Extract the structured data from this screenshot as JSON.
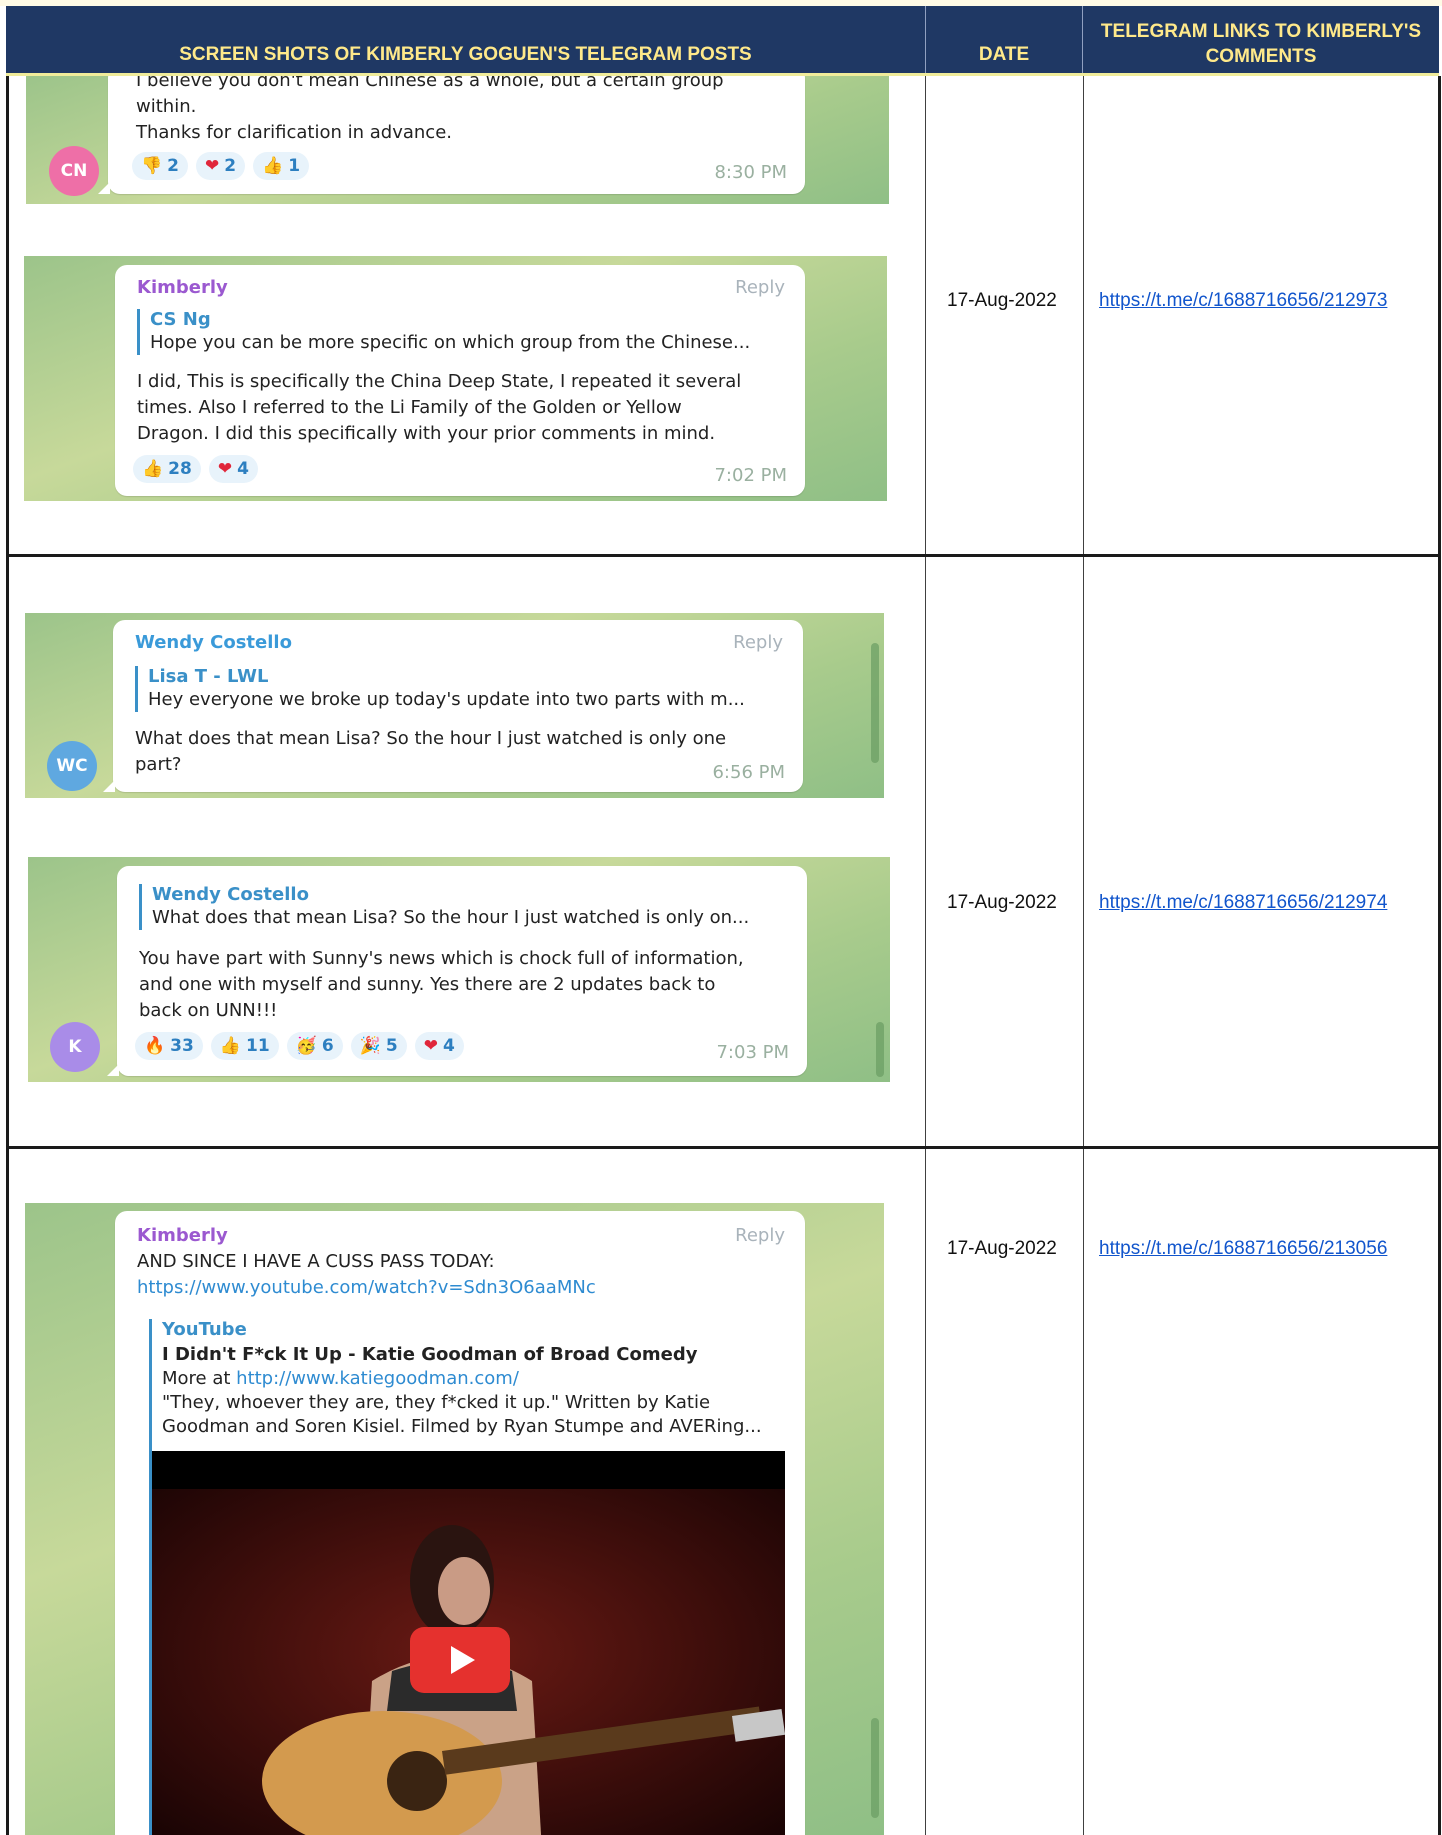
{
  "header": {
    "col1": "SCREEN SHOTS OF KIMBERLY GOGUEN'S TELEGRAM POSTS",
    "col2": "DATE",
    "col3": "TELEGRAM LINKS TO KIMBERLY'S COMMENTS"
  },
  "rows": [
    {
      "date": "17-Aug-2022",
      "link": "https://t.me/c/1688716656/212973",
      "msg_a": {
        "text": "I believe you don't mean Chinese as a whole, but a certain group within.\nThanks for clarification in advance.",
        "line1": "I believe you don't mean Chinese as a whole, but a certain group",
        "line2": "within.",
        "line3": "Thanks for clarification in advance.",
        "avatar": "CN",
        "reactions": [
          {
            "icon": "thumbs-down-icon",
            "count": "2"
          },
          {
            "icon": "heart-icon",
            "count": "2"
          },
          {
            "icon": "thumbs-up-icon",
            "count": "1"
          }
        ],
        "time": "8:30 PM"
      },
      "msg_b": {
        "author": "Kimberly",
        "reply": "Reply",
        "quote_name": "CS Ng",
        "quote_text": "Hope you can be more specific on which group from the Chinese...",
        "line1": "I did, This is specifically the China Deep State, I repeated it several",
        "line2": "times. Also I referred to the Li Family of the Golden or Yellow",
        "line3": "Dragon. I did this specifically with your prior comments in mind.",
        "reactions": [
          {
            "icon": "thumbs-up-icon",
            "count": "28"
          },
          {
            "icon": "heart-icon",
            "count": "4"
          }
        ],
        "time": "7:02 PM"
      }
    },
    {
      "date": "17-Aug-2022",
      "link": "https://t.me/c/1688716656/212974",
      "msg_a": {
        "author": "Wendy Costello",
        "reply": "Reply",
        "quote_name": "Lisa T - LWL",
        "quote_text": "Hey everyone we broke up today's update into two parts with m...",
        "line1": "What does that mean Lisa? So the hour I just watched is only one",
        "line2": "part?",
        "avatar": "WC",
        "time": "6:56 PM"
      },
      "msg_b": {
        "quote_name": "Wendy Costello",
        "quote_text": "What does that mean Lisa? So the hour I just watched is only on...",
        "line1": "You have part with Sunny's news which is chock full of information,",
        "line2": "and one with myself and sunny. Yes there are 2 updates back to",
        "line3": "back on UNN!!!",
        "avatar": "K",
        "reactions": [
          {
            "icon": "fire-icon",
            "count": "33"
          },
          {
            "icon": "thumbs-up-icon",
            "count": "11"
          },
          {
            "icon": "party-face-icon",
            "count": "6"
          },
          {
            "icon": "party-popper-icon",
            "count": "5"
          },
          {
            "icon": "heart-icon",
            "count": "4"
          }
        ],
        "time": "7:03 PM"
      }
    },
    {
      "date": "17-Aug-2022",
      "link": "https://t.me/c/1688716656/213056",
      "msg_a": {
        "author": "Kimberly",
        "reply": "Reply",
        "line1": "AND SINCE I HAVE A CUSS PASS TODAY:",
        "url": "https://www.youtube.com/watch?v=Sdn3O6aaMNc",
        "preview_site": "YouTube",
        "preview_title": "I Didn't F*ck It Up - Katie Goodman of Broad Comedy",
        "preview_more_prefix": "More at ",
        "preview_more_link": "http://www.katiegoodman.com/",
        "preview_desc1": "\"They, whoever they are, they f*cked it up.\" Written by Katie",
        "preview_desc2": "Goodman and Soren Kisiel. Filmed by Ryan Stumpe and AVERing..."
      }
    }
  ],
  "colors": {
    "header_bg": "#1f3864",
    "header_text": "#ffe98a",
    "link": "#1155cc",
    "kimberly_name": "#9b59d0",
    "wendy_name": "#3a9ad9",
    "avatar_cn": "#ee6fa7",
    "avatar_wc": "#5fa8e0",
    "avatar_k": "#a98ce8"
  }
}
